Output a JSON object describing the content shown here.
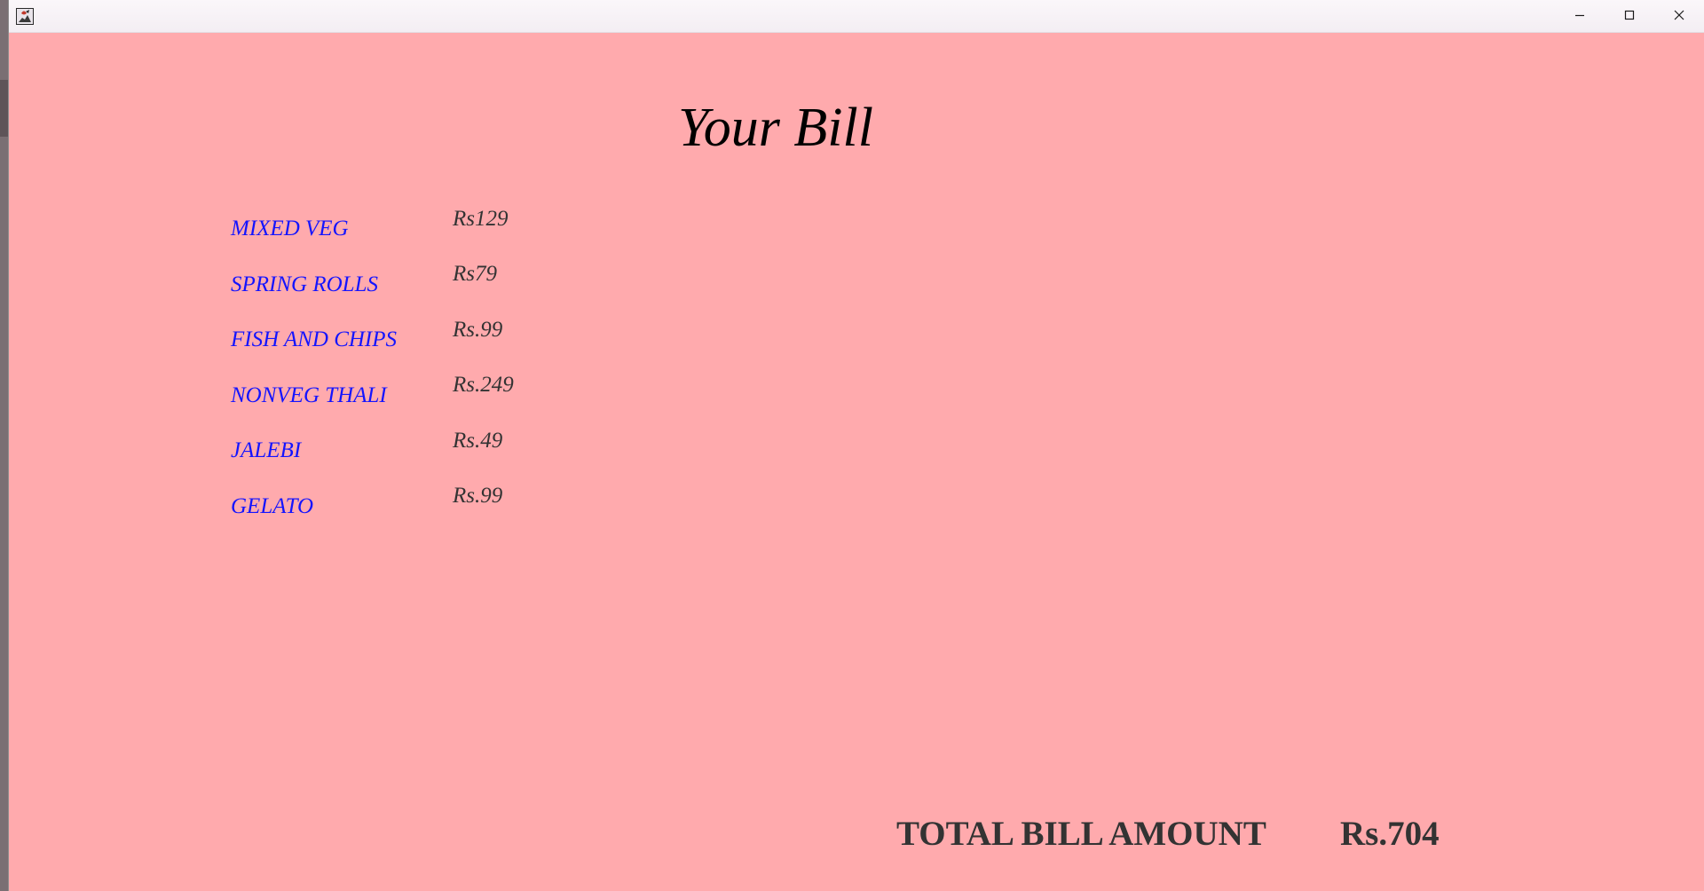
{
  "window": {
    "icon": "java-app-icon",
    "controls": [
      "minimize-icon",
      "maximize-icon",
      "close-icon"
    ]
  },
  "bill": {
    "title": "Your Bill",
    "items": [
      {
        "name": "MIXED VEG",
        "price": "Rs129"
      },
      {
        "name": "SPRING ROLLS",
        "price": "Rs79"
      },
      {
        "name": "FISH AND CHIPS",
        "price": "Rs.99"
      },
      {
        "name": "NONVEG THALI",
        "price": "Rs.249"
      },
      {
        "name": "JALEBI",
        "price": "Rs.49"
      },
      {
        "name": "GELATO",
        "price": "Rs.99"
      }
    ],
    "total_label": "TOTAL BILL AMOUNT",
    "total_value": "Rs.704"
  },
  "colors": {
    "background": "#ffaaad",
    "item_name": "#1414ff",
    "price": "#333333",
    "title": "#000000"
  }
}
